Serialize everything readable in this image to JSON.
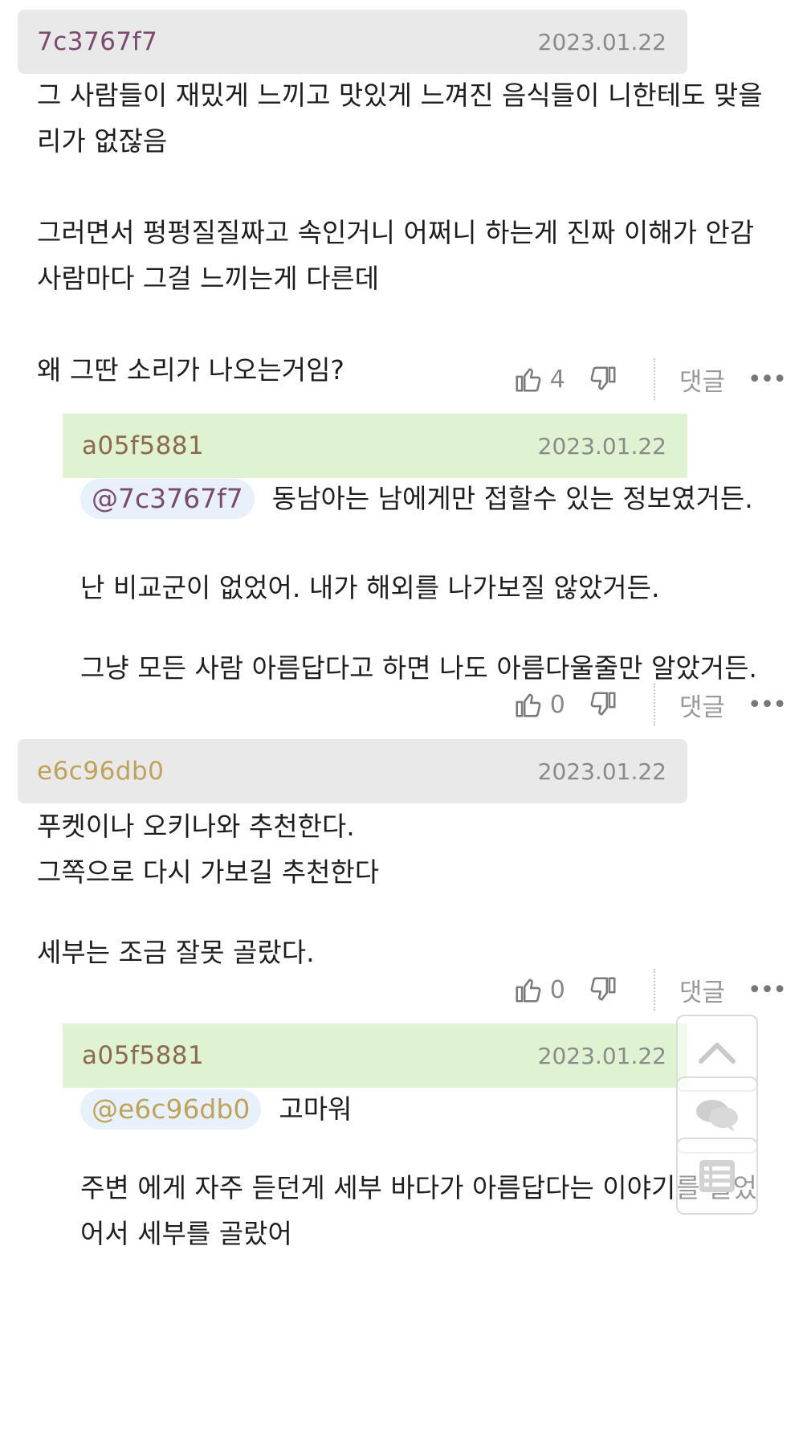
{
  "colors": {
    "header_bg": "#e9e9e9",
    "reply_header_bg": "#dff3d3",
    "mention_bg": "#e8f1fb",
    "author_7c": "#7b4a6e",
    "author_a05": "#8d6a4e",
    "author_e6c": "#c0a35a"
  },
  "comments": [
    {
      "author": "7c3767f7",
      "date": "2023.01.22",
      "lines": [
        "그 사람들이 재밌게 느끼고 맛있게 느껴진 음식들이 니한테도 맞을",
        "리가 없잖음",
        "",
        "그러면서 펑펑질질짜고 속인거니 어쩌니 하는게 진짜 이해가 안감",
        "사람마다 그걸 느끼는게 다른데",
        "",
        "왜 그딴 소리가 나오는거임?"
      ],
      "likes": "4",
      "reply_label": "댓글",
      "more": "•••"
    },
    {
      "author": "a05f5881",
      "date": "2023.01.22",
      "mention": "@7c3767f7",
      "first_line": "동남아는 남에게만 접할수 있는 정보였거든.",
      "lines": [
        "",
        "난 비교군이 없었어. 내가 해외를 나가보질 않았거든.",
        "",
        "그냥 모든 사람 아름답다고 하면 나도 아름다울줄만 알았거든."
      ],
      "likes": "0",
      "reply_label": "댓글",
      "more": "•••"
    },
    {
      "author": "e6c96db0",
      "date": "2023.01.22",
      "lines": [
        "푸켓이나 오키나와 추천한다.",
        "그쪽으로 다시 가보길 추천한다",
        "",
        "세부는 조금 잘못 골랐다."
      ],
      "likes": "0",
      "reply_label": "댓글",
      "more": "•••"
    },
    {
      "author": "a05f5881",
      "date": "2023.01.22",
      "mention": "@e6c96db0",
      "first_line": "고마워",
      "lines": [
        "",
        "주변 에게 자주 듣던게 세부 바다가 아름답다는 이야기를 들었",
        "어서 세부를 골랐어"
      ]
    }
  ],
  "float_buttons": [
    "scroll-top",
    "comments",
    "list"
  ]
}
